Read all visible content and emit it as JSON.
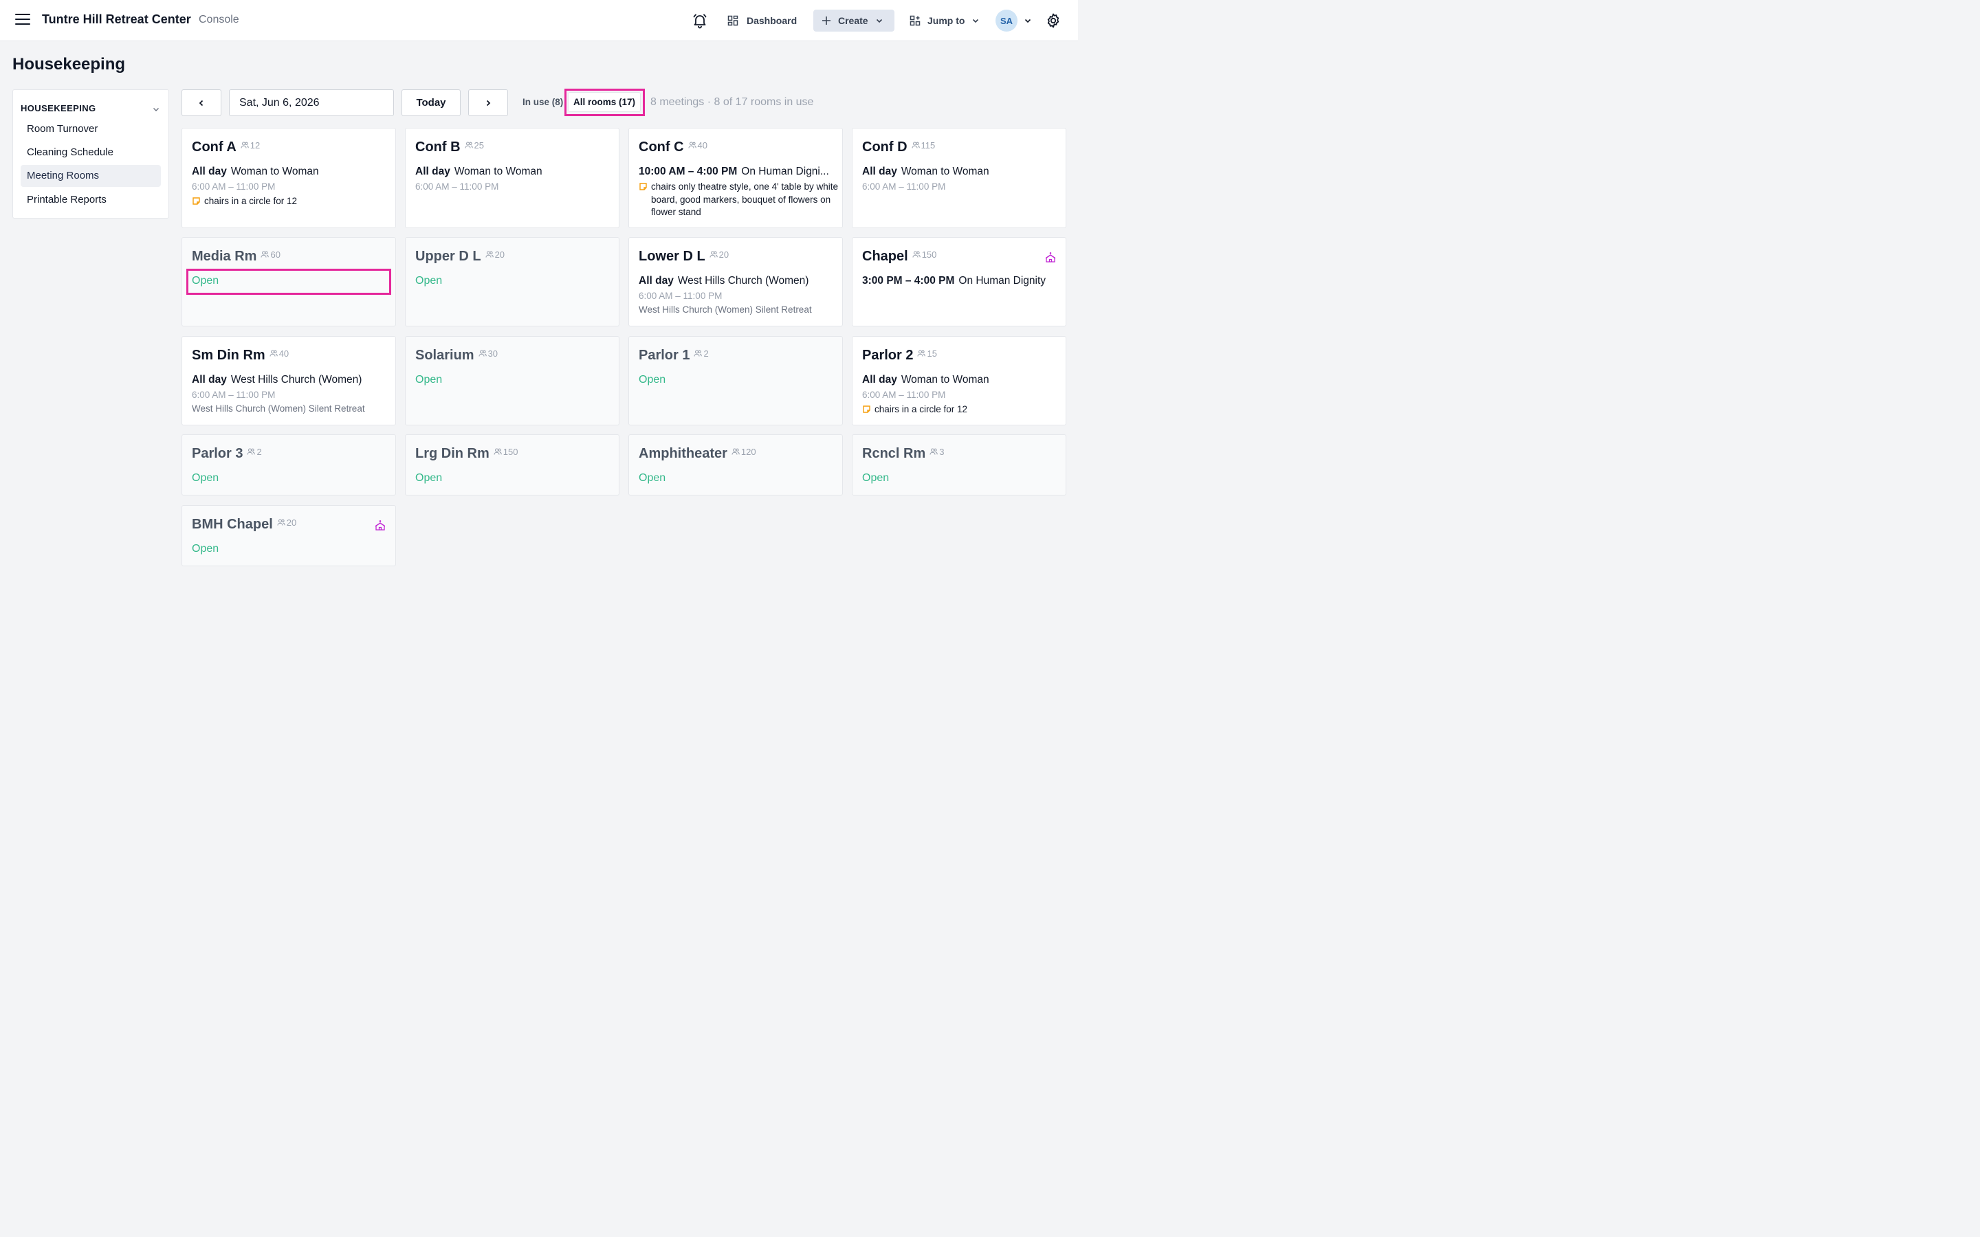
{
  "app": {
    "title": "Tuntre Hill Retreat Center",
    "subtitle": "Console"
  },
  "header": {
    "dashboard_label": "Dashboard",
    "create_label": "Create",
    "jump_label": "Jump to",
    "avatar_initials": "SA"
  },
  "page": {
    "title": "Housekeeping"
  },
  "sidebar": {
    "heading": "HOUSEKEEPING",
    "items": [
      {
        "label": "Room Turnover",
        "active": false
      },
      {
        "label": "Cleaning Schedule",
        "active": false
      },
      {
        "label": "Meeting Rooms",
        "active": true
      },
      {
        "label": "Printable Reports",
        "active": false
      }
    ]
  },
  "toolbar": {
    "date_value": "Sat, Jun 6, 2026",
    "today_label": "Today",
    "in_use_label": "In use (8)",
    "all_rooms_label": "All rooms (17)",
    "summary": "8 meetings · 8 of 17 rooms in use"
  },
  "open_label": "Open",
  "colors": {
    "accent_highlight": "#e5279b",
    "open_green": "#34b88a",
    "chapel_purple": "#c026d3",
    "note_orange": "#f59e0b"
  },
  "rooms": [
    {
      "name": "Conf A",
      "capacity": "12",
      "time": "All day",
      "meeting": "Woman to Woman",
      "hours": "6:00 AM – 11:00 PM",
      "note": "chairs in a circle for 12"
    },
    {
      "name": "Conf B",
      "capacity": "25",
      "time": "All day",
      "meeting": "Woman to Woman",
      "hours": "6:00 AM – 11:00 PM"
    },
    {
      "name": "Conf C",
      "capacity": "40",
      "time": "10:00 AM – 4:00 PM",
      "meeting": "On Human Digni...",
      "note": "chairs only theatre style, one 4' table by white board, good markers, bouquet of flowers on flower stand"
    },
    {
      "name": "Conf D",
      "capacity": "115",
      "time": "All day",
      "meeting": "Woman to Woman",
      "hours": "6:00 AM – 11:00 PM"
    },
    {
      "name": "Media Rm",
      "capacity": "60"
    },
    {
      "name": "Upper D L",
      "capacity": "20"
    },
    {
      "name": "Lower D L",
      "capacity": "20",
      "time": "All day",
      "meeting": "West Hills Church (Women)",
      "hours": "6:00 AM – 11:00 PM",
      "group": "West Hills Church (Women) Silent Retreat"
    },
    {
      "name": "Chapel",
      "capacity": "150",
      "time": "3:00 PM – 4:00 PM",
      "meeting": "On Human Dignity",
      "icon": "chapel-icon"
    },
    {
      "name": "Sm Din Rm",
      "capacity": "40",
      "time": "All day",
      "meeting": "West Hills Church (Women)",
      "hours": "6:00 AM – 11:00 PM",
      "group": "West Hills Church (Women) Silent Retreat"
    },
    {
      "name": "Solarium",
      "capacity": "30"
    },
    {
      "name": "Parlor 1",
      "capacity": "2"
    },
    {
      "name": "Parlor 2",
      "capacity": "15",
      "time": "All day",
      "meeting": "Woman to Woman",
      "hours": "6:00 AM – 11:00 PM",
      "note": "chairs in a circle for 12"
    },
    {
      "name": "Parlor 3",
      "capacity": "2"
    },
    {
      "name": "Lrg Din Rm",
      "capacity": "150"
    },
    {
      "name": "Amphitheater",
      "capacity": "120"
    },
    {
      "name": "Rcncl Rm",
      "capacity": "3"
    },
    {
      "name": "BMH Chapel",
      "capacity": "20",
      "icon": "chapel-icon"
    }
  ]
}
